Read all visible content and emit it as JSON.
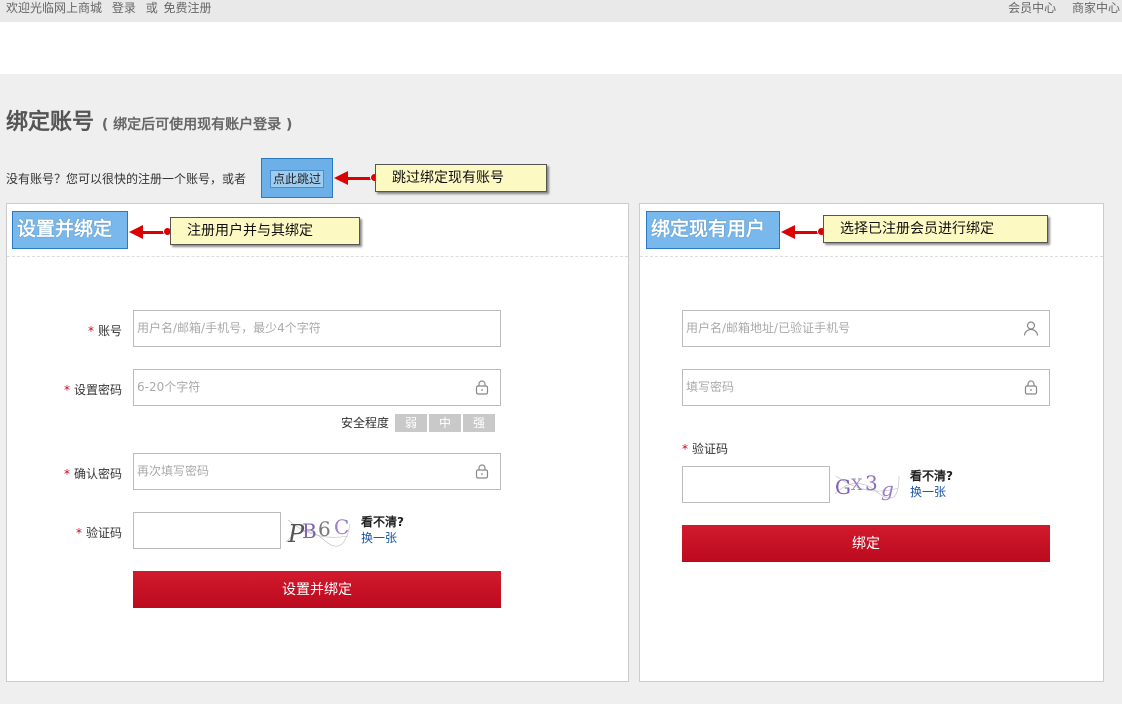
{
  "topbar": {
    "welcome": "欢迎光临网上商城",
    "login": "登录",
    "or": "或",
    "register": "免费注册",
    "member_center": "会员中心",
    "merchant_center": "商家中心"
  },
  "header": {
    "title": "绑定账号",
    "subtitle": "( 绑定后可使用现有账户登录 )"
  },
  "skip": {
    "text": "没有账号？您可以很快的注册一个账号，或者",
    "button_label": "点此跳过",
    "callout": "跳过绑定现有账号"
  },
  "register_panel": {
    "tag": "设置并绑定",
    "callout": "注册用户并与其绑定",
    "account_label": "账号",
    "account_placeholder": "用户名/邮箱/手机号，最少4个字符",
    "password_label": "设置密码",
    "password_placeholder": "6-20个字符",
    "strength_label": "安全程度",
    "strength_levels": [
      "弱",
      "中",
      "强"
    ],
    "confirm_label": "确认密码",
    "confirm_placeholder": "再次填写密码",
    "captcha_label": "验证码",
    "captcha_text": "PB6C",
    "cant_see": "看不清?",
    "swap": "换一张",
    "submit": "设置并绑定"
  },
  "bind_panel": {
    "tag": "绑定现有用户",
    "callout": "选择已注册会员进行绑定",
    "user_placeholder": "用户名/邮箱地址/已验证手机号",
    "password_placeholder": "填写密码",
    "captcha_label": "验证码",
    "captcha_text": "GX3g",
    "cant_see": "看不清?",
    "swap": "换一张",
    "submit": "绑定"
  },
  "colors": {
    "accent_red": "#c8102e",
    "tag_blue": "#79b8ec",
    "callout_yellow": "#fdf9c3"
  }
}
